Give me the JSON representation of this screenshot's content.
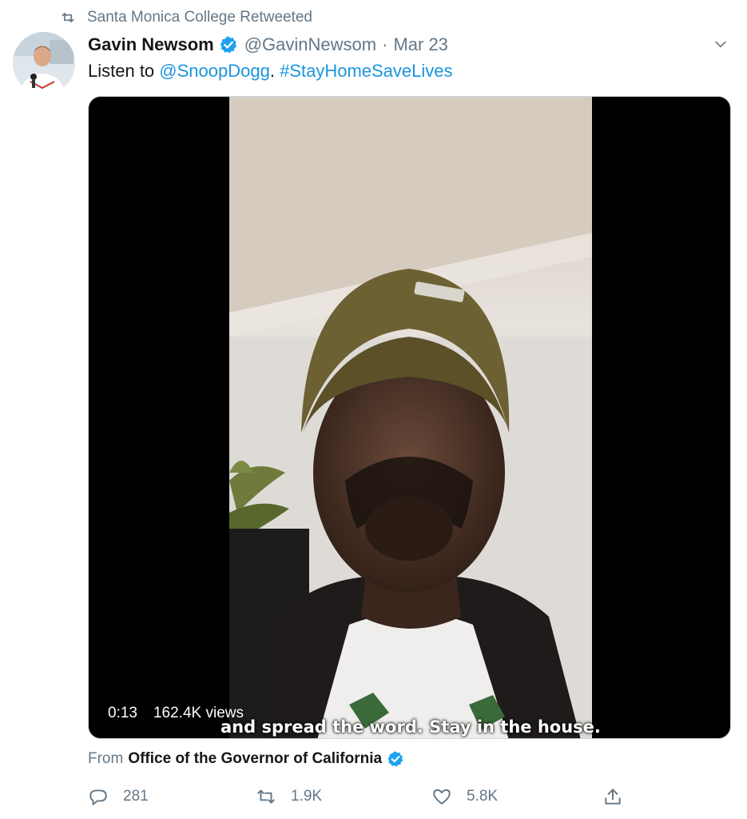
{
  "social_context": {
    "text": "Santa Monica College Retweeted",
    "icon": "retweet-icon"
  },
  "tweet": {
    "author": {
      "display_name": "Gavin Newsom",
      "handle": "@GavinNewsom",
      "verified": true,
      "avatar": "avatar-photo"
    },
    "separator": "·",
    "date": "Mar 23",
    "text": {
      "prefix": "Listen to ",
      "mention": "@SnoopDogg",
      "middle": ". ",
      "hashtag": "#StayHomeSaveLives"
    },
    "media": {
      "type": "video",
      "elapsed": "0:13",
      "views": "162.4K views",
      "subtitle": "and spread the word. Stay in the house."
    },
    "attribution": {
      "prefix": "From",
      "source": "Office of the Governor of California",
      "verified": true
    },
    "actions": {
      "reply": {
        "icon": "reply-icon",
        "count": "281"
      },
      "retweet": {
        "icon": "retweet-icon",
        "count": "1.9K"
      },
      "like": {
        "icon": "heart-icon",
        "count": "5.8K"
      },
      "share": {
        "icon": "share-icon",
        "count": ""
      }
    }
  },
  "colors": {
    "link": "#1b95e0",
    "secondary_text": "#657786",
    "primary_text": "#14171a",
    "verified_badge": "#1da1f2",
    "media_border": "#ccd6dd"
  }
}
